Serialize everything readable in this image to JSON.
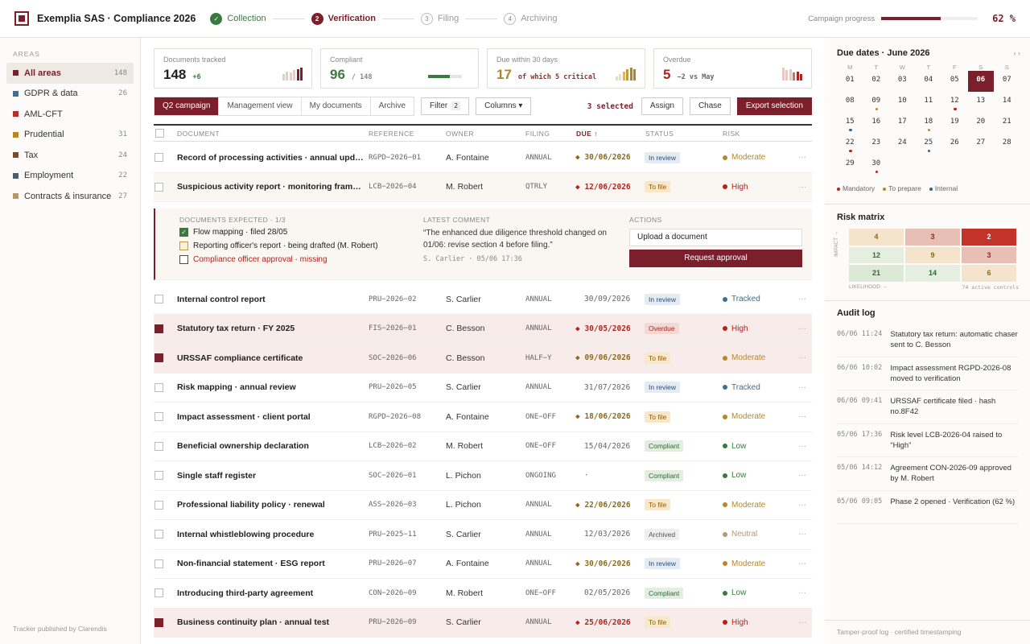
{
  "app": {
    "title": "Exemplia SAS · Compliance 2026"
  },
  "steps": [
    {
      "num": "✓",
      "label": "Collection",
      "state": "done"
    },
    {
      "num": "2",
      "label": "Verification",
      "state": "active"
    },
    {
      "num": "3",
      "label": "Filing",
      "state": "todo"
    },
    {
      "num": "4",
      "label": "Archiving",
      "state": "todo"
    }
  ],
  "progress": {
    "label": "Campaign progress",
    "value": 62,
    "text": "62 %"
  },
  "sidebar": {
    "heading": "AREAS",
    "items": [
      {
        "label": "All areas",
        "count": "148",
        "color": "#7a1f2b",
        "active": true
      },
      {
        "label": "GDPR & data",
        "count": "26",
        "color": "#3f6f94"
      },
      {
        "label": "AML-CFT",
        "count": "",
        "color": "#b0322a"
      },
      {
        "label": "Prudential",
        "count": "31",
        "color": "#b7862a"
      },
      {
        "label": "Tax",
        "count": "24",
        "color": "#7a4a2a"
      },
      {
        "label": "Employment",
        "count": "22",
        "color": "#4a5e6e"
      },
      {
        "label": "Contracts & insurance",
        "count": "27",
        "color": "#b09a72"
      }
    ],
    "footer": "Tracker published by Clarendis"
  },
  "kpis": [
    {
      "label": "Documents tracked",
      "value": "148",
      "sub": "+6",
      "subColor": "#3b7a3e",
      "valueColor": "#222",
      "kind": "spark",
      "spark": [
        0.5,
        0.7,
        0.6,
        0.8,
        0.9,
        1.0
      ],
      "sparkColors": [
        "#e0cfca",
        "#e0cfca",
        "#e0cfca",
        "#e0cfca",
        "#7a1f2b",
        "#7a1f2b"
      ]
    },
    {
      "label": "Compliant",
      "value": "96",
      "sub": "/ 148",
      "subColor": "#888",
      "valueColor": "#3b7a3e",
      "kind": "bar",
      "fraction": 0.65
    },
    {
      "label": "Due within 30 days",
      "value": "17",
      "sub": "of which 5 critical",
      "subColor": "#a3281d",
      "valueColor": "#b08528",
      "kind": "spark",
      "spark": [
        0.3,
        0.5,
        0.7,
        0.9,
        1.0,
        0.85
      ],
      "sparkColors": [
        "#ecdcb4",
        "#ecdcb4",
        "#d8b868",
        "#c49a3a",
        "#b08528",
        "#b08528"
      ]
    },
    {
      "label": "Overdue",
      "value": "5",
      "sub": "−2 vs May",
      "subColor": "#666",
      "valueColor": "#b0241d",
      "kind": "spark",
      "spark": [
        1.0,
        0.8,
        0.9,
        0.6,
        0.7,
        0.5
      ],
      "sparkColors": [
        "#e8c8c2",
        "#e8c8c2",
        "#e8c8c2",
        "#c87065",
        "#b0241d",
        "#b0241d"
      ]
    }
  ],
  "toolbar": {
    "tabs": [
      "Q2 campaign",
      "Management view",
      "My documents",
      "Archive"
    ],
    "filter_label": "Filter",
    "filter_count": "2",
    "columns_label": "Columns ▾",
    "selected": "3 selected",
    "assign": "Assign",
    "chase": "Chase",
    "export": "Export selection"
  },
  "columns": [
    "DOCUMENT",
    "REFERENCE",
    "OWNER",
    "FILING",
    "DUE ↑",
    "STATUS",
    "RISK"
  ],
  "rows": [
    {
      "doc": "Record of processing activities · annual update",
      "ref": "RGPD−2026−01",
      "owner": "A. Fontaine",
      "filing": "ANNUAL",
      "due": "30/06/2026",
      "dueType": "warn",
      "status": "In review",
      "statusType": "review",
      "risk": "Moderate",
      "riskColor": "#b7862a",
      "checked": false,
      "hi": false
    },
    {
      "doc": "Suspicious activity report · monitoring framework",
      "ref": "LCB−2026−04",
      "owner": "M. Robert",
      "filing": "QTRLY",
      "due": "12/06/2026",
      "dueType": "crit",
      "status": "To file",
      "statusType": "file",
      "risk": "High",
      "riskColor": "#b0241d",
      "checked": false,
      "hi": false,
      "tint": true
    },
    {
      "doc": "Internal control report",
      "ref": "PRU−2026−02",
      "owner": "S. Carlier",
      "filing": "ANNUAL",
      "due": "30/09/2026",
      "dueType": "plain",
      "status": "In review",
      "statusType": "review",
      "risk": "Tracked",
      "riskColor": "#3f6f94",
      "checked": false,
      "hi": false
    },
    {
      "doc": "Statutory tax return · FY 2025",
      "ref": "FIS−2026−01",
      "owner": "C. Besson",
      "filing": "ANNUAL",
      "due": "30/05/2026",
      "dueType": "crit",
      "status": "Overdue",
      "statusType": "over",
      "risk": "High",
      "riskColor": "#b0241d",
      "checked": true,
      "hi": true
    },
    {
      "doc": "URSSAF compliance certificate",
      "ref": "SOC−2026−06",
      "owner": "C. Besson",
      "filing": "HALF−Y",
      "due": "09/06/2026",
      "dueType": "warn",
      "status": "To file",
      "statusType": "file",
      "risk": "Moderate",
      "riskColor": "#b7862a",
      "checked": true,
      "hi": true
    },
    {
      "doc": "Risk mapping · annual review",
      "ref": "PRU−2026−05",
      "owner": "S. Carlier",
      "filing": "ANNUAL",
      "due": "31/07/2026",
      "dueType": "plain",
      "status": "In review",
      "statusType": "review",
      "risk": "Tracked",
      "riskColor": "#3f6f94",
      "checked": false,
      "hi": false
    },
    {
      "doc": "Impact assessment · client portal",
      "ref": "RGPD−2026−08",
      "owner": "A. Fontaine",
      "filing": "ONE−OFF",
      "due": "18/06/2026",
      "dueType": "warn",
      "status": "To file",
      "statusType": "file",
      "risk": "Moderate",
      "riskColor": "#b7862a",
      "checked": false,
      "hi": false
    },
    {
      "doc": "Beneficial ownership declaration",
      "ref": "LCB−2026−02",
      "owner": "M. Robert",
      "filing": "ONE−OFF",
      "due": "15/04/2026",
      "dueType": "plain",
      "status": "Compliant",
      "statusType": "comp",
      "risk": "Low",
      "riskColor": "#3b7a3e",
      "checked": false,
      "hi": false
    },
    {
      "doc": "Single staff register",
      "ref": "SOC−2026−01",
      "owner": "L. Pichon",
      "filing": "ONGOING",
      "due": "·",
      "dueType": "plain",
      "status": "Compliant",
      "statusType": "comp",
      "risk": "Low",
      "riskColor": "#3b7a3e",
      "checked": false,
      "hi": false
    },
    {
      "doc": "Professional liability policy · renewal",
      "ref": "ASS−2026−03",
      "owner": "L. Pichon",
      "filing": "ANNUAL",
      "due": "22/06/2026",
      "dueType": "warn",
      "status": "To file",
      "statusType": "file",
      "risk": "Moderate",
      "riskColor": "#b7862a",
      "checked": false,
      "hi": false
    },
    {
      "doc": "Internal whistleblowing procedure",
      "ref": "PRU−2025−11",
      "owner": "S. Carlier",
      "filing": "ANNUAL",
      "due": "12/03/2026",
      "dueType": "plain",
      "status": "Archived",
      "statusType": "arch",
      "risk": "Neutral",
      "riskColor": "#b09a72",
      "checked": false,
      "hi": false
    },
    {
      "doc": "Non-financial statement · ESG report",
      "ref": "PRU−2026−07",
      "owner": "A. Fontaine",
      "filing": "ANNUAL",
      "due": "30/06/2026",
      "dueType": "warn",
      "status": "In review",
      "statusType": "review",
      "risk": "Moderate",
      "riskColor": "#b7862a",
      "checked": false,
      "hi": false
    },
    {
      "doc": "Introducing third-party agreement",
      "ref": "CON−2026−09",
      "owner": "M. Robert",
      "filing": "ONE−OFF",
      "due": "02/05/2026",
      "dueType": "plain",
      "status": "Compliant",
      "statusType": "comp",
      "risk": "Low",
      "riskColor": "#3b7a3e",
      "checked": false,
      "hi": false
    },
    {
      "doc": "Business continuity plan · annual test",
      "ref": "PRU−2026−09",
      "owner": "S. Carlier",
      "filing": "ANNUAL",
      "due": "25/06/2026",
      "dueType": "crit",
      "status": "To file",
      "statusType": "file",
      "risk": "High",
      "riskColor": "#b0241d",
      "checked": true,
      "hi": true
    }
  ],
  "expanded": {
    "docs_heading": "DOCUMENTS EXPECTED · 1/3",
    "docs": [
      {
        "text": "Flow mapping · filed 28/05",
        "state": "done"
      },
      {
        "text": "Reporting officer's report · being drafted (M. Robert)",
        "state": "pending"
      },
      {
        "text": "Compliance officer approval · missing",
        "state": "missing"
      }
    ],
    "comment_heading": "LATEST COMMENT",
    "comment": "“The enhanced due diligence threshold changed on 01/06: revise section 4 before filing.”",
    "comment_meta": "S. Carlier · 05/06 17:36",
    "actions_heading": "ACTIONS",
    "upload": "Upload a document",
    "request": "Request approval"
  },
  "calendar": {
    "title": "Due dates · June 2026",
    "nav": "‹ ›",
    "days": [
      "M",
      "T",
      "W",
      "T",
      "F",
      "S",
      "S"
    ],
    "weeks": [
      [
        {
          "d": "01"
        },
        {
          "d": "02"
        },
        {
          "d": "03"
        },
        {
          "d": "04"
        },
        {
          "d": "05"
        },
        {
          "d": "06",
          "today": true
        },
        {
          "d": "07"
        }
      ],
      [
        {
          "d": "08"
        },
        {
          "d": "09",
          "dot": "#b7862a"
        },
        {
          "d": "10"
        },
        {
          "d": "11"
        },
        {
          "d": "12",
          "dot": "#b0241d"
        },
        {
          "d": "13"
        },
        {
          "d": "14"
        }
      ],
      [
        {
          "d": "15",
          "dot": "#3f5f7e"
        },
        {
          "d": "16"
        },
        {
          "d": "17"
        },
        {
          "d": "18",
          "dot": "#b7862a"
        },
        {
          "d": "19"
        },
        {
          "d": "20"
        },
        {
          "d": "21"
        }
      ],
      [
        {
          "d": "22",
          "dot": "#b0241d"
        },
        {
          "d": "23"
        },
        {
          "d": "24"
        },
        {
          "d": "25",
          "dot": "#3f5f7e"
        },
        {
          "d": "26"
        },
        {
          "d": "27"
        },
        {
          "d": "28"
        }
      ],
      [
        {
          "d": "29"
        },
        {
          "d": "30",
          "dot": "#b0241d"
        },
        {
          "d": ""
        },
        {
          "d": ""
        },
        {
          "d": ""
        },
        {
          "d": ""
        },
        {
          "d": ""
        }
      ]
    ],
    "legend": [
      {
        "label": "Mandatory",
        "color": "#b0241d"
      },
      {
        "label": "To prepare",
        "color": "#b7862a"
      },
      {
        "label": "Internal",
        "color": "#3f5f7e"
      }
    ]
  },
  "matrix": {
    "title": "Risk matrix",
    "ylabel": "IMPACT →",
    "xlabel": "LIKELIHOOD →",
    "note": "74 active controls",
    "cells": [
      {
        "v": "4",
        "bg": "#f4e4cc",
        "fg": "#8a6a1c"
      },
      {
        "v": "3",
        "bg": "#e8bfb4",
        "fg": "#8a2a20"
      },
      {
        "v": "2",
        "bg": "#c3332a",
        "fg": "#fff"
      },
      {
        "v": "12",
        "bg": "#e4efe0",
        "fg": "#3a6a3a"
      },
      {
        "v": "9",
        "bg": "#f4e4cc",
        "fg": "#8a6a1c"
      },
      {
        "v": "3",
        "bg": "#e8bfb4",
        "fg": "#8a2a20"
      },
      {
        "v": "21",
        "bg": "#dce9d6",
        "fg": "#2f6a32"
      },
      {
        "v": "14",
        "bg": "#e4efe0",
        "fg": "#2f6a32"
      },
      {
        "v": "6",
        "bg": "#f4e4cc",
        "fg": "#8a6a1c"
      }
    ]
  },
  "audit": {
    "title": "Audit log",
    "items": [
      {
        "t": "06/06 11:24",
        "d": "Statutory tax return: automatic chaser sent to C. Besson"
      },
      {
        "t": "06/06 10:02",
        "d": "Impact assessment RGPD-2026-08 moved to verification"
      },
      {
        "t": "06/06 09:41",
        "d": "URSSAF certificate filed · hash no.8F42"
      },
      {
        "t": "05/06 17:36",
        "d": "Risk level LCB-2026-04 raised to “High”"
      },
      {
        "t": "05/06 14:12",
        "d": "Agreement CON-2026-09 approved by M. Robert"
      },
      {
        "t": "05/06 09:05",
        "d": "Phase 2 opened · Verification (62 %)"
      }
    ],
    "footer": "Tamper-proof log · certified timestamping"
  }
}
